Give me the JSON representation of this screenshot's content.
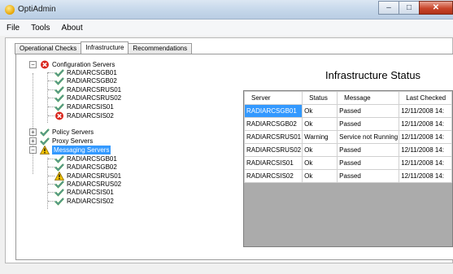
{
  "window": {
    "title": "OptiAdmin",
    "min_glyph": "–",
    "max_glyph": "□",
    "close_glyph": "✕"
  },
  "menu": [
    "File",
    "Tools",
    "About"
  ],
  "tabs": [
    {
      "label": "Operational Checks",
      "active": false
    },
    {
      "label": "Infrastructure",
      "active": true
    },
    {
      "label": "Recommendations",
      "active": false
    }
  ],
  "tree": {
    "config_group": {
      "label": "Configuration Servers",
      "icon": "error-icon"
    },
    "config_children": [
      {
        "label": "RADIARCSGB01",
        "icon": "check-icon"
      },
      {
        "label": "RADIARCSGB02",
        "icon": "check-icon"
      },
      {
        "label": "RADIARCSRUS01",
        "icon": "check-icon"
      },
      {
        "label": "RADIARCSRUS02",
        "icon": "check-icon"
      },
      {
        "label": "RADIARCSIS01",
        "icon": "check-icon"
      },
      {
        "label": "RADIARCSIS02",
        "icon": "error-icon"
      }
    ],
    "policy_group": {
      "label": "Policy Servers",
      "icon": "check-icon"
    },
    "proxy_group": {
      "label": "Proxy Servers",
      "icon": "check-icon"
    },
    "messaging_group": {
      "label": "Messaging Servers",
      "icon": "warning-icon"
    },
    "messaging_children": [
      {
        "label": "RADIARCSGB01",
        "icon": "check-icon"
      },
      {
        "label": "RADIARCSGB02",
        "icon": "check-icon"
      },
      {
        "label": "RADIARCSRUS01",
        "icon": "warning-icon"
      },
      {
        "label": "RADIARCSRUS02",
        "icon": "check-icon"
      },
      {
        "label": "RADIARCSIS01",
        "icon": "check-icon"
      },
      {
        "label": "RADIARCSIS02",
        "icon": "check-icon"
      }
    ]
  },
  "status": {
    "title": "Infrastructure Status",
    "columns": [
      "Server",
      "Status",
      "Message",
      "Last Checked"
    ],
    "rows": [
      [
        "RADIARCSGB01",
        "Ok",
        "Passed",
        "12/11/2008 14:"
      ],
      [
        "RADIARCSGB02",
        "Ok",
        "Passed",
        "12/11/2008 14:"
      ],
      [
        "RADIARCSRUS01",
        "Warning",
        "Service not Running",
        "12/11/2008 14:"
      ],
      [
        "RADIARCSRUS02",
        "Ok",
        "Passed",
        "12/11/2008 14:"
      ],
      [
        "RADIARCSIS01",
        "Ok",
        "Passed",
        "12/11/2008 14:"
      ],
      [
        "RADIARCSIS02",
        "Ok",
        "Passed",
        "12/11/2008 14:"
      ]
    ]
  },
  "colors": {
    "selection": "#3399ff",
    "ok_check": "#2a9a2a",
    "error": "#d9261c",
    "warning": "#f2c200"
  }
}
